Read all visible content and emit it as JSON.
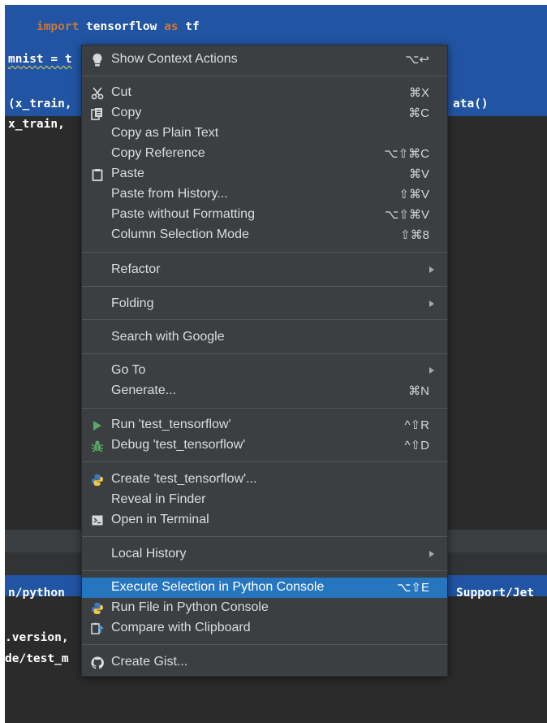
{
  "editor": {
    "code_lines": [
      {
        "keyword": "import",
        "rest": " tensorflow ",
        "keyword2": "as",
        "rest2": " tf"
      },
      {
        "text": "mnist = t"
      },
      {
        "text": "(x_train,"
      },
      {
        "text": "x_train, "
      },
      {
        "text": "ata()"
      }
    ],
    "console_lines": [
      {
        "text": "n/python "
      },
      {
        "text": "Support/Jet"
      },
      {
        "text": ".version, "
      },
      {
        "text": "de/test_m"
      }
    ]
  },
  "context_menu": {
    "items": [
      {
        "id": "show-context-actions",
        "label": "Show Context Actions",
        "shortcut": "⌥↩",
        "icon": "lightbulb-icon"
      },
      {
        "id": "cut",
        "label": "Cut",
        "shortcut": "⌘X",
        "icon": "scissors-icon"
      },
      {
        "id": "copy",
        "label": "Copy",
        "shortcut": "⌘C",
        "icon": "copy-icon"
      },
      {
        "id": "copy-plain",
        "label": "Copy as Plain Text",
        "shortcut": ""
      },
      {
        "id": "copy-reference",
        "label": "Copy Reference",
        "shortcut": "⌥⇧⌘C"
      },
      {
        "id": "paste",
        "label": "Paste",
        "shortcut": "⌘V",
        "icon": "clipboard-icon"
      },
      {
        "id": "paste-history",
        "label": "Paste from History...",
        "shortcut": "⇧⌘V"
      },
      {
        "id": "paste-no-format",
        "label": "Paste without Formatting",
        "shortcut": "⌥⇧⌘V"
      },
      {
        "id": "column-selection",
        "label": "Column Selection Mode",
        "shortcut": "⇧⌘8"
      },
      {
        "id": "refactor",
        "label": "Refactor",
        "submenu": true
      },
      {
        "id": "folding",
        "label": "Folding",
        "submenu": true
      },
      {
        "id": "search-google",
        "label": "Search with Google"
      },
      {
        "id": "go-to",
        "label": "Go To",
        "submenu": true
      },
      {
        "id": "generate",
        "label": "Generate...",
        "shortcut": "⌘N"
      },
      {
        "id": "run",
        "label": "Run 'test_tensorflow'",
        "shortcut": "^⇧R",
        "icon": "run-icon"
      },
      {
        "id": "debug",
        "label": "Debug 'test_tensorflow'",
        "shortcut": "^⇧D",
        "icon": "debug-icon"
      },
      {
        "id": "create-config",
        "label": "Create 'test_tensorflow'...",
        "icon": "python-icon"
      },
      {
        "id": "reveal-finder",
        "label": "Reveal in Finder"
      },
      {
        "id": "open-terminal",
        "label": "Open in Terminal",
        "icon": "terminal-icon"
      },
      {
        "id": "local-history",
        "label": "Local History",
        "submenu": true
      },
      {
        "id": "execute-selection",
        "label": "Execute Selection in Python Console",
        "shortcut": "⌥⇧E",
        "highlighted": true
      },
      {
        "id": "run-file-console",
        "label": "Run File in Python Console",
        "icon": "python-icon"
      },
      {
        "id": "compare-clipboard",
        "label": "Compare with Clipboard",
        "icon": "compare-icon"
      },
      {
        "id": "create-gist",
        "label": "Create Gist...",
        "icon": "github-icon"
      }
    ]
  },
  "colors": {
    "selection": "#2154a2",
    "menu_bg": "#3c3f41",
    "highlight": "#2675bf",
    "run_green": "#59a869",
    "python_blue": "#3e7bbf",
    "python_yellow": "#f3c94a"
  }
}
